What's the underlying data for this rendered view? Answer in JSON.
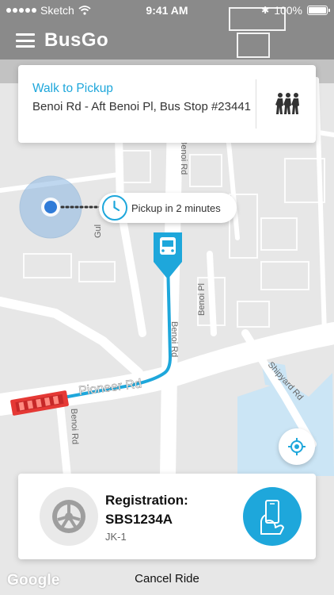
{
  "status_bar": {
    "carrier": "Sketch",
    "time": "9:41 AM",
    "battery": "100%"
  },
  "header": {
    "brand": "BusGo"
  },
  "pickup_card": {
    "title": "Walk to Pickup",
    "address": "Benoi Rd - Aft Benoi Pl, Bus Stop #23441"
  },
  "map": {
    "road_labels": {
      "pioneer_rd": "Pioneer Rd",
      "benoi_rd_upper": "Benoi Rd",
      "benoi_rd_lower": "Benoi Rd",
      "benoi_rd_left": "Benoi Rd",
      "benoi_pl": "Benoi Pl",
      "shipyard_rd": "Shipyard Rd",
      "gul": "Gul"
    },
    "tooltip": "Pickup in 2 minutes",
    "route_color": "#1ea7db",
    "bus_color": "#e53935"
  },
  "driver_card": {
    "registration_label": "Registration:",
    "registration_value": "SBS1234A",
    "route": "JK-1"
  },
  "footer": {
    "attribution": "Google",
    "cancel_label": "Cancel Ride"
  },
  "icons": {
    "menu": "hamburger-icon",
    "walking": "people-walking-icon",
    "locate": "locate-icon",
    "clock": "clock-icon",
    "bus": "bus-stop-icon",
    "wheel": "steering-wheel-icon",
    "board": "hand-holding-phone-icon"
  }
}
